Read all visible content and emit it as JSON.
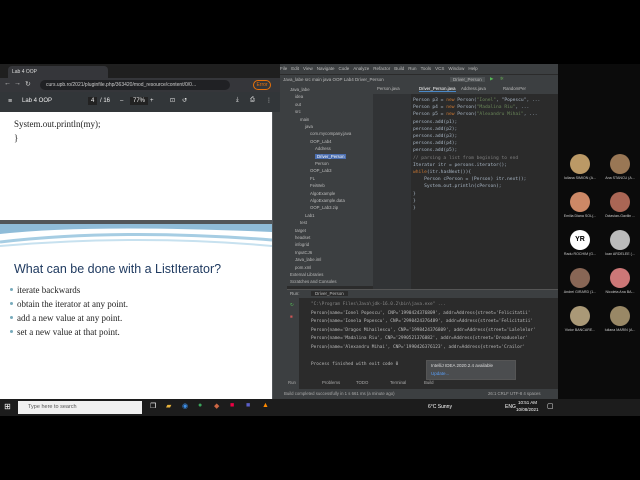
{
  "browser": {
    "tab_title": "Lab 4 OOP",
    "url": "curs.upb.ro/2021/pluginfile.php/363420/mod_resource/content/0/0...",
    "error_label": "Error"
  },
  "pdf": {
    "title": "Lab 4 OOP",
    "page": "4",
    "page_total": "/ 16",
    "zoom": "77%"
  },
  "page1_code": [
    "System.out.println(my);",
    "}"
  ],
  "slide": {
    "title": "What can be done with a ListIterator?",
    "bullets": [
      "iterate backwards",
      "obtain the iterator at any point.",
      "add a new value at any point.",
      "set a new value at that point."
    ]
  },
  "ide": {
    "menu": [
      "File",
      "Edit",
      "View",
      "Navigate",
      "Code",
      "Analyze",
      "Refactor",
      "Build",
      "Run",
      "Tools",
      "VCS",
      "Window",
      "Help"
    ],
    "breadcrumb": "Java_labe  src  main  java  OOP  Lab4  Driver_Person",
    "run_config": "Driver_Person",
    "project_items": [
      "Java_labe",
      "idea",
      "out",
      "src",
      "main",
      "java",
      "com.mycompany.java",
      "OOP_Lab4",
      "Address",
      "Driver_Person",
      "Person",
      "OOP_Lab3",
      "FL",
      "FeiWeb",
      "AlgoExample",
      "AlgoExample.data",
      "OOP_Lab3.zip",
      "Lab1",
      "test",
      "target",
      "headset",
      "infogrid",
      "InputCJ6",
      "Java_labe.iml",
      "pom.xml",
      "External Libraries",
      "Scratches and Consoles"
    ],
    "editor_tabs": [
      "Person.java",
      "Driver_Person.java",
      "Address.java",
      "RandomPer"
    ],
    "code": [
      {
        "t": "Person p3 = ",
        "k": "new ",
        "r": "Person(",
        "s": "\"Ionel\"",
        "e": ", \"Popescu\", ..."
      },
      {
        "t": "Person p4 = ",
        "k": "new ",
        "r": "Person(",
        "s": "\"Madalina Riu\"",
        "e": ", ..."
      },
      {
        "t": "Person p5 = ",
        "k": "new ",
        "r": "Person(",
        "s": "\"Alexandru Mihai\"",
        "e": ", ..."
      },
      {
        "t": "persons.add(p1);"
      },
      {
        "t": "persons.add(p2);"
      },
      {
        "t": "persons.add(p3);"
      },
      {
        "t": "persons.add(p4);"
      },
      {
        "t": "persons.add(p5);"
      },
      {
        "c": "// parsing a list from begining to end"
      },
      {
        "t": "Iterator itr = persons.iterator();"
      },
      {
        "k": "while",
        "t": "(itr.hasNext()){"
      },
      {
        "t": "    Person cPerson = (Person) itr.next();"
      },
      {
        "t": "    System.out.println(cPerson);"
      },
      {
        "t": "}"
      },
      {
        "t": "}"
      },
      {
        "t": "}"
      }
    ],
    "run_tab": "Driver_Person",
    "output": [
      "\"C:\\Program Files\\Java\\jdk-16.0.2\\bin\\java.exe\" ...",
      "Person{name='Ionel Popescu', CNP='1990424376809', addr=Address{street='Felicitatii'",
      "Person{name='Ionela Popescu', CNP='2990424376489', addr=Address{street='Felicitatii'",
      "Person{name='Dragos Mihailescu', CNP='1998424376809', addr=Address{street='Lalelelor'",
      "Person{name='Madalina Riu', CNP='2990521376882', addr=Address{street='Dreaduselor'",
      "Person{name='Alexandru Mihai', CNP='1990426376123', addr=Address{street='Crailor'",
      "",
      "Process finished with exit code 0"
    ],
    "notify_title": "IntelliJ IDEA 2020.2.4 available",
    "notify_link": "Update...",
    "bottom_tabs": [
      "Run",
      "Problems",
      "TODO",
      "Terminal",
      "Build"
    ],
    "status": "Build completed successfully in 1 s 661 ms (a minute ago)",
    "status_right": "26:1  CRLF  UTF-8  4 spaces"
  },
  "taskbar": {
    "search_placeholder": "Type here to search",
    "weather": "6°C Sunny",
    "lang": "ENG",
    "time": "10:51 AM",
    "date": "10/08/2021"
  },
  "participants": [
    {
      "name": "Iuliana SIMION (A...",
      "color": "#b96"
    },
    {
      "name": "Ana STANCU (A...",
      "color": "#975"
    },
    {
      "name": "Emilia Diana SOL(...",
      "color": "#c86"
    },
    {
      "name": "Octavian-Gavilin ...",
      "color": "#a65"
    },
    {
      "name": "Radu ROCHIM (G...",
      "initials": "YR"
    },
    {
      "name": "Ioan ARDELEE (...",
      "color": "#bbb"
    },
    {
      "name": "Andrei GIRARD (1...",
      "color": "#865"
    },
    {
      "name": "Nicoleta Ana BA...",
      "color": "#c77"
    },
    {
      "name": "Victor BANCARE...",
      "color": "#a97"
    },
    {
      "name": "Iuliana MARIN (A...",
      "color": "#986"
    }
  ]
}
